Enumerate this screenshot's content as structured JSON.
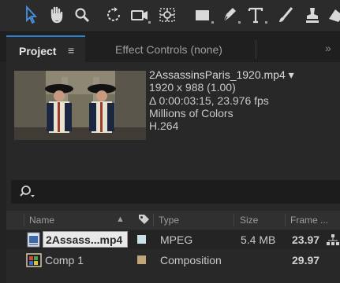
{
  "toolbar": {
    "tools": [
      "selection-tool",
      "hand-tool",
      "zoom-tool",
      "rotation-tool",
      "camera-tool",
      "pan-behind-tool",
      "rectangle-tool",
      "pen-tool",
      "type-tool",
      "brush-tool",
      "clone-stamp-tool"
    ]
  },
  "tabs": {
    "project": "Project",
    "project_menu": "≡",
    "effect_controls": "Effect Controls (none)",
    "overflow": "»"
  },
  "preview": {
    "filename": "2AssassinsParis_1920.mp4 ▾",
    "dimensions": "1920 x 988 (1.00)",
    "duration": "Δ 0:00:03:15, 23.976 fps",
    "colors": "Millions of Colors",
    "codec": "H.264"
  },
  "search": {
    "icon": "search-icon",
    "dropdown": "▾"
  },
  "columns": {
    "name": "Name",
    "sort": "▲",
    "label_icon": "tag-icon",
    "type": "Type",
    "size": "Size",
    "frame": "Frame ..."
  },
  "rows": [
    {
      "name": "2Assass...mp4",
      "label_color": "#c8e0e8",
      "type": "MPEG",
      "size": "5.4 MB",
      "frame": "23.97",
      "icon": "footage-icon"
    },
    {
      "name": "Comp 1",
      "label_color": "#bfa679",
      "type": "Composition",
      "size": "",
      "frame": "29.97",
      "icon": "composition-icon"
    }
  ],
  "colors": {
    "accent": "#2f7fd1",
    "panel": "#282828",
    "background": "#232323"
  }
}
